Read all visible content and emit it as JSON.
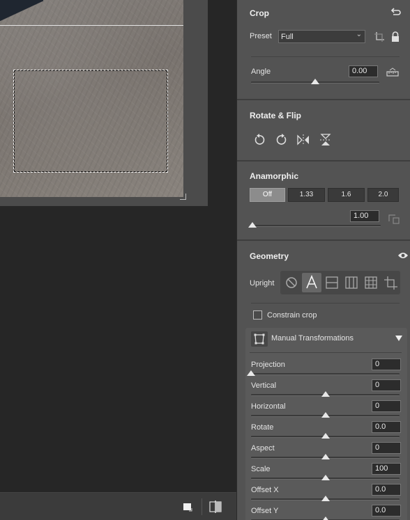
{
  "crop": {
    "title": "Crop",
    "preset_label": "Preset",
    "preset_value": "Full",
    "angle_label": "Angle",
    "angle_value": "0.00"
  },
  "rotate_flip": {
    "title": "Rotate & Flip"
  },
  "anamorphic": {
    "title": "Anamorphic",
    "options": [
      "Off",
      "1.33",
      "1.6",
      "2.0"
    ],
    "selected": "Off",
    "value": "1.00"
  },
  "geometry": {
    "title": "Geometry",
    "upright_label": "Upright",
    "upright_selected": "auto",
    "constrain_crop_label": "Constrain crop",
    "constrain_crop_checked": false,
    "manual_title": "Manual Transformations",
    "sliders": [
      {
        "label": "Projection",
        "value": "0",
        "level": 0.0
      },
      {
        "label": "Vertical",
        "value": "0",
        "level": 0.5
      },
      {
        "label": "Horizontal",
        "value": "0",
        "level": 0.5
      },
      {
        "label": "Rotate",
        "value": "0.0",
        "level": 0.5
      },
      {
        "label": "Aspect",
        "value": "0",
        "level": 0.5
      },
      {
        "label": "Scale",
        "value": "100",
        "level": 0.5
      },
      {
        "label": "Offset X",
        "value": "0.0",
        "level": 0.5
      },
      {
        "label": "Offset Y",
        "value": "0.0",
        "level": 0.5
      }
    ]
  },
  "sliders_levels": {
    "angle": 0.5,
    "anamorphic": 0.0
  },
  "colors": {
    "panel_bg": "#535353",
    "canvas_bg": "#262626",
    "active_segment": "#8c8c8c"
  }
}
